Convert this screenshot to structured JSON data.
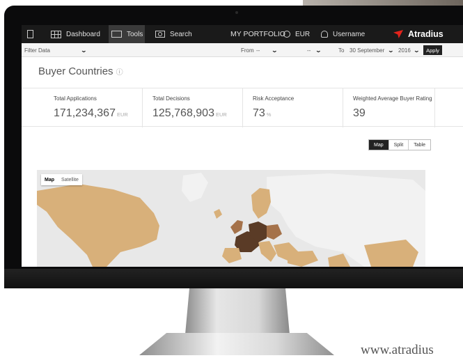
{
  "topbar": {
    "dashboard": "Dashboard",
    "tools": "Tools",
    "search": "Search",
    "portfolio": "MY PORTFOLIO",
    "currency": "EUR",
    "username": "Username",
    "logo": "Atradius"
  },
  "filter": {
    "label": "Filter Data",
    "from_label": "From",
    "from_month": "--",
    "from_year": "--",
    "to_label": "To",
    "to_date": "30 September",
    "to_year": "2016",
    "apply": "Apply"
  },
  "page": {
    "title": "Buyer Countries",
    "info_icon": "ⓘ"
  },
  "kpis": [
    {
      "label": "Total Applications",
      "value": "171,234,367",
      "unit": "EUR"
    },
    {
      "label": "Total Decisions",
      "value": "125,768,903",
      "unit": "EUR"
    },
    {
      "label": "Risk Acceptance",
      "value": "73",
      "unit": "%"
    },
    {
      "label": "Weighted Average Buyer Rating",
      "value": "39",
      "unit": ""
    }
  ],
  "view_switch": [
    "Map",
    "Split",
    "Table"
  ],
  "map": {
    "toggle": [
      "Map",
      "Satellite"
    ],
    "colors": {
      "light": "#d8b07a",
      "medium": "#a5724a",
      "dark": "#5a3b26",
      "ocean": "#e8e8e8",
      "unshaded": "#f2f2f2"
    }
  },
  "footer_url": "www.atradius"
}
